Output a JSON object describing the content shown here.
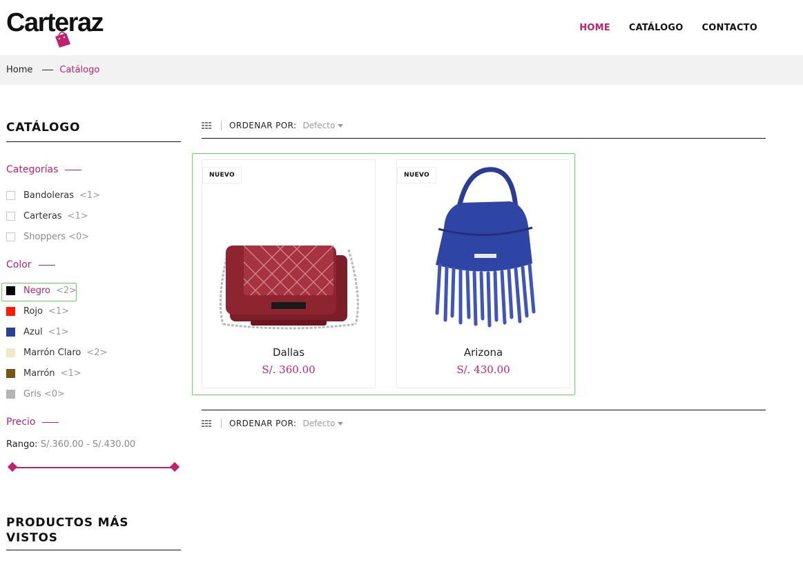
{
  "brand": {
    "name": "Carteraz",
    "accent": "#c2216e"
  },
  "nav": {
    "items": [
      "HOME",
      "CATÁLOGO",
      "CONTACTO"
    ],
    "active": "HOME"
  },
  "breadcrumb": {
    "home": "Home",
    "current": "Catálogo"
  },
  "sidebar": {
    "title": "CATÁLOGO",
    "categories": {
      "heading": "Categorías",
      "items": [
        {
          "name": "Bandoleras",
          "count": "<1>"
        },
        {
          "name": "Carteras",
          "count": "<1>"
        },
        {
          "name": "Shoppers",
          "count": "<0>"
        }
      ]
    },
    "colors": {
      "heading": "Color",
      "items": [
        {
          "name": "Negro",
          "count": "<2>",
          "swatch": "#000000"
        },
        {
          "name": "Rojo",
          "count": "<1>",
          "swatch": "#ff1a00"
        },
        {
          "name": "Azul",
          "count": "<1>",
          "swatch": "#2b3f9a"
        },
        {
          "name": "Marrón Claro",
          "count": "<2>",
          "swatch": "#eeebc4"
        },
        {
          "name": "Marrón",
          "count": "<1>",
          "swatch": "#7a5412"
        },
        {
          "name": "Gris",
          "count": "<0>",
          "swatch": "#b4b4b4"
        }
      ]
    },
    "price": {
      "heading": "Precio",
      "range_label": "Rango:",
      "range_value": "S/.360.00 - S/.430.00"
    },
    "most_viewed_title": "PRODUCTOS MÁS VISTOS"
  },
  "toolbar": {
    "sort_label": "ORDENAR POR:",
    "sort_value": "Defecto"
  },
  "products": [
    {
      "badge": "NUEVO",
      "name": "Dallas",
      "price": "S/. 360.00"
    },
    {
      "badge": "NUEVO",
      "name": "Arizona",
      "price": "S/. 430.00"
    }
  ]
}
